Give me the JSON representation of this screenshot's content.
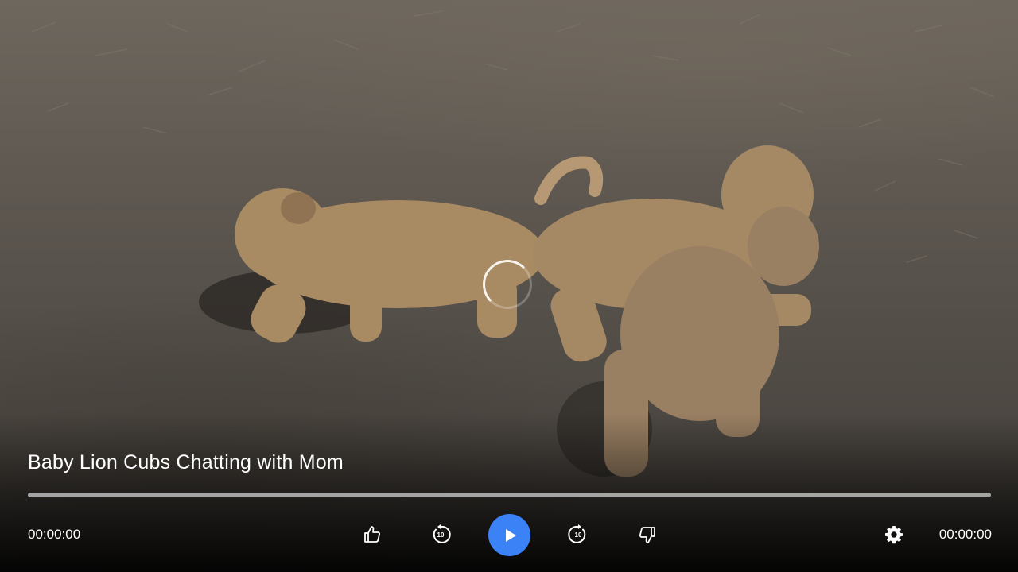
{
  "video": {
    "title": "Baby Lion Cubs Chatting with Mom",
    "loading": true
  },
  "playback": {
    "current_time": "00:00:00",
    "total_time": "00:00:00",
    "progress_fraction": 0
  },
  "controls": {
    "like_icon": "thumbs-up-icon",
    "rewind_icon": "rewind-10-icon",
    "rewind_label": "10",
    "play_icon": "play-icon",
    "forward_icon": "forward-10-icon",
    "forward_label": "10",
    "dislike_icon": "thumbs-down-icon",
    "settings_icon": "gear-icon"
  },
  "colors": {
    "accent": "#3b82f6",
    "text": "#ffffff"
  }
}
